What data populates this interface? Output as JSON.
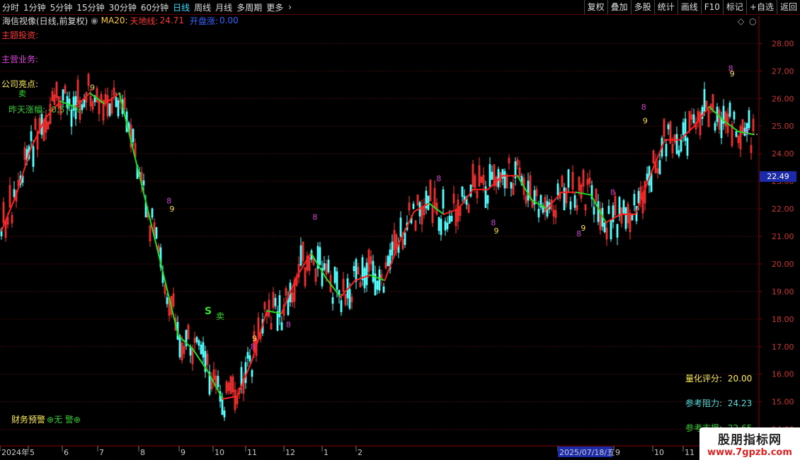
{
  "toolbar": {
    "timeframes": [
      "分时",
      "1分钟",
      "5分钟",
      "15分钟",
      "30分钟",
      "60分钟",
      "日线",
      "周线",
      "月线",
      "多周期",
      "更多"
    ],
    "active": "日线",
    "right_buttons": [
      "复权",
      "叠加",
      "多股",
      "统计",
      "画线",
      "F10",
      "标记",
      "+自选",
      "返回"
    ]
  },
  "info": {
    "stock": "海信视像(日线,前复权)",
    "ma_label": "MA20:",
    "tiandi_label": "天地线:",
    "tiandi_value": "24.71",
    "kaipan_label": "开盘涨:",
    "kaipan_value": "0.00"
  },
  "labels": {
    "theme": "主题投资:",
    "business": "主营业务:",
    "highlight": "公司亮点:",
    "prev_change": "昨天涨幅: -0.57 %",
    "finance_warning": "财务预警",
    "finance_warning_value": "无 警",
    "sell1": "卖",
    "sell2": "S",
    "sell2_text": "卖"
  },
  "stats": {
    "score_label": "量化评分:",
    "score_value": "20.00",
    "resist_label": "参考阻力:",
    "resist_value": "24.23",
    "support_label": "参考支撑:",
    "support_value": "22.65"
  },
  "current_price": "22.49",
  "watermark": {
    "line1": "股朋指标网",
    "line2": "www.7gpzb.com"
  },
  "colors": {
    "up": "#ff3333",
    "down": "#55ffff",
    "ma_up": "#ff2020",
    "ma_down": "#22dd22",
    "grid": "#8a0000",
    "magenta": "#cc44cc"
  },
  "chart_data": {
    "type": "candlestick",
    "ylim": [
      13.4,
      28.6
    ],
    "yticks": [
      14.0,
      15.0,
      16.0,
      17.0,
      18.0,
      19.0,
      20.0,
      21.0,
      22.0,
      23.0,
      24.0,
      25.0,
      26.0,
      27.0,
      28.0
    ],
    "xticks": [
      "2024年",
      "5",
      "6",
      "7",
      "8",
      "9",
      "10",
      "11",
      "12",
      "1",
      "2",
      "2025/07/18/五",
      "9",
      "10",
      "11"
    ],
    "ma_points": [
      [
        0,
        21.2
      ],
      [
        1,
        22.5
      ],
      [
        2,
        24.2
      ],
      [
        3,
        25.3
      ],
      [
        4,
        25.9
      ],
      [
        5,
        25.7
      ],
      [
        6,
        26.2
      ],
      [
        7,
        25.8
      ],
      [
        8,
        26.2
      ],
      [
        9,
        24.0
      ],
      [
        10,
        21.8
      ],
      [
        11,
        19.6
      ],
      [
        12,
        17.4
      ],
      [
        13,
        16.9
      ],
      [
        14,
        16.1
      ],
      [
        15,
        15.1
      ],
      [
        16,
        15.2
      ],
      [
        17,
        16.5
      ],
      [
        18,
        18.3
      ],
      [
        19,
        18.2
      ],
      [
        20,
        19.5
      ],
      [
        21,
        20.4
      ],
      [
        22,
        19.5
      ],
      [
        23,
        18.8
      ],
      [
        24,
        19.4
      ],
      [
        25,
        19.6
      ],
      [
        26,
        19.4
      ],
      [
        27,
        20.8
      ],
      [
        28,
        21.9
      ],
      [
        29,
        22.2
      ],
      [
        30,
        21.8
      ],
      [
        31,
        22.0
      ],
      [
        32,
        22.7
      ],
      [
        33,
        22.7
      ],
      [
        34,
        23.2
      ],
      [
        35,
        23.2
      ],
      [
        36,
        22.3
      ],
      [
        37,
        22.0
      ],
      [
        38,
        22.6
      ],
      [
        39,
        22.6
      ],
      [
        40,
        22.5
      ],
      [
        41,
        21.5
      ],
      [
        42,
        21.8
      ],
      [
        43,
        21.8
      ],
      [
        44,
        23.2
      ],
      [
        45,
        24.5
      ],
      [
        46,
        24.5
      ],
      [
        47,
        25.0
      ],
      [
        48,
        25.7
      ],
      [
        49,
        25.2
      ],
      [
        50,
        24.8
      ],
      [
        51,
        24.7
      ]
    ],
    "sequence_marks": [
      {
        "t": "9",
        "i": 6,
        "p": 26.3,
        "c": "#ffdd55"
      },
      {
        "t": "9",
        "i": 11.4,
        "p": 21.9,
        "c": "#ffdd55"
      },
      {
        "t": "8",
        "i": 11.2,
        "p": 22.2,
        "c": "#cc44cc"
      },
      {
        "t": "8",
        "i": 16.9,
        "p": 16.9,
        "c": "#cc44cc"
      },
      {
        "t": "9",
        "i": 17,
        "p": 17.2,
        "c": "#ffdd55"
      },
      {
        "t": "8",
        "i": 19.3,
        "p": 17.7,
        "c": "#cc44cc"
      },
      {
        "t": "8",
        "i": 21.1,
        "p": 21.6,
        "c": "#cc44cc"
      },
      {
        "t": "8",
        "i": 29.5,
        "p": 23.0,
        "c": "#cc44cc"
      },
      {
        "t": "8",
        "i": 41.3,
        "p": 22.5,
        "c": "#cc44cc"
      },
      {
        "t": "8",
        "i": 33.2,
        "p": 21.4,
        "c": "#cc44cc"
      },
      {
        "t": "9",
        "i": 33.4,
        "p": 21.1,
        "c": "#ffdd55"
      },
      {
        "t": "8",
        "i": 39.0,
        "p": 21.0,
        "c": "#cc44cc"
      },
      {
        "t": "9",
        "i": 39.3,
        "p": 21.2,
        "c": "#ffdd55"
      },
      {
        "t": "8",
        "i": 43.4,
        "p": 25.6,
        "c": "#cc44cc"
      },
      {
        "t": "9",
        "i": 43.5,
        "p": 25.1,
        "c": "#ffdd55"
      },
      {
        "t": "8",
        "i": 49.3,
        "p": 27.0,
        "c": "#cc44cc"
      },
      {
        "t": "9",
        "i": 49.4,
        "p": 26.8,
        "c": "#ffdd55"
      },
      {
        "t": "8",
        "i": 50.4,
        "p": 24.7,
        "c": "#cc44cc"
      }
    ]
  }
}
